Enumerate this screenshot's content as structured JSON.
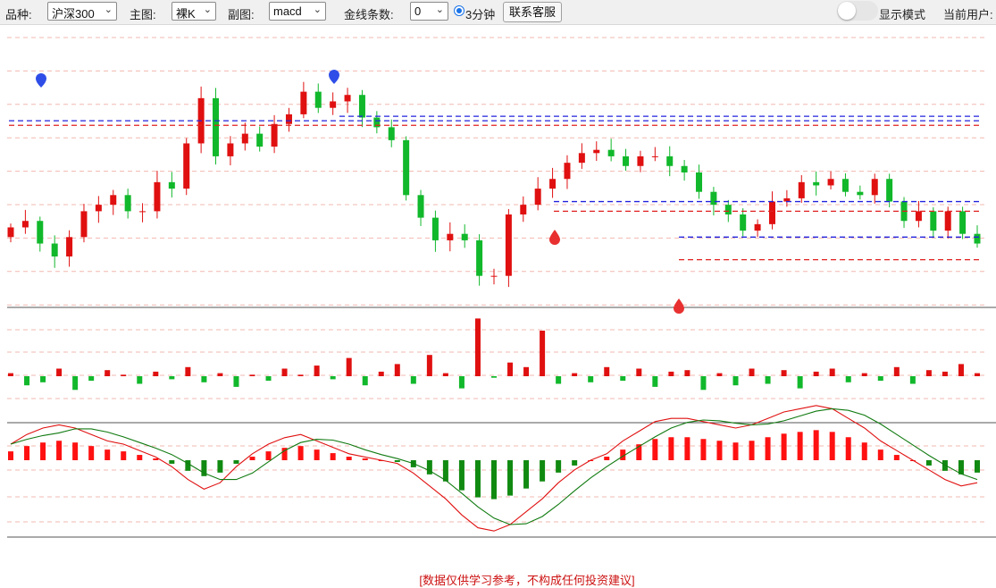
{
  "toolbar": {
    "variety_label": "品种:",
    "variety_value": "沪深300",
    "main_label": "主图:",
    "main_value": "裸K",
    "sub_label": "副图:",
    "sub_value": "macd",
    "lines_label": "金线条数:",
    "lines_value": "0",
    "period_label": "3分钟",
    "contact_label": "联系客服",
    "display_mode_label": "显示模式",
    "current_user_label": "当前用户:"
  },
  "disclaimer": "[数据仅供学习参考，不构成任何投资建议]",
  "icons": [
    "chevron-down-icon",
    "radio-selected-icon",
    "toggle-switch-icon",
    "map-pin-icon",
    "drop-marker-icon"
  ],
  "colors": {
    "up": "#e01010",
    "down": "#11b82b",
    "dif": "#e01010",
    "dea": "#107a10",
    "macd_up": "#ff1111",
    "macd_down": "#118a11",
    "level_blue": "#2222dd",
    "level_red": "#e02020",
    "pin_blue": "#2f4ee8",
    "pin_red": "#e83030"
  },
  "chart_data": [
    {
      "type": "candlestick",
      "title": "",
      "close": [
        0.8,
        0.9,
        0.55,
        0.35,
        0.65,
        1.05,
        1.15,
        1.3,
        1.05,
        1.05,
        1.5,
        1.4,
        2.1,
        2.8,
        1.9,
        2.1,
        2.25,
        2.05,
        2.4,
        2.55,
        2.9,
        2.65,
        2.75,
        2.85,
        2.5,
        2.35,
        2.15,
        1.3,
        0.95,
        0.6,
        0.7,
        0.6,
        0.05,
        0.05,
        1.0,
        1.15,
        1.4,
        1.55,
        1.8,
        1.95,
        2.0,
        1.9,
        1.75,
        1.9,
        1.9,
        1.75,
        1.65,
        1.35,
        1.15,
        1.0,
        0.75,
        0.85,
        1.2,
        1.25,
        1.5,
        1.45,
        1.55,
        1.35,
        1.3,
        1.55,
        1.2,
        0.9,
        1.05,
        0.75,
        1.05,
        0.7,
        0.55
      ]
    },
    {
      "type": "bar",
      "title": "",
      "values": [
        0.2,
        -0.6,
        -0.4,
        0.5,
        -0.9,
        -0.3,
        0.4,
        0.1,
        -0.5,
        0.3,
        -0.2,
        0.6,
        -0.4,
        0.2,
        -0.7,
        0.1,
        -0.3,
        0.5,
        0.1,
        0.7,
        -0.2,
        1.2,
        -0.6,
        0.3,
        0.8,
        -0.5,
        1.4,
        0.2,
        -0.8,
        3.8,
        -0.1,
        0.9,
        0.6,
        3.0,
        -0.5,
        0.2,
        -0.4,
        0.6,
        -0.3,
        0.5,
        -0.7,
        0.3,
        0.4,
        -0.9,
        0.2,
        -0.6,
        0.5,
        -0.5,
        0.4,
        -0.8,
        0.3,
        0.5,
        -0.4,
        0.2,
        -0.3,
        0.6,
        -0.5,
        0.4,
        0.3,
        0.8,
        0.2
      ]
    },
    {
      "type": "bar",
      "title": "",
      "values": [
        0.5,
        0.8,
        1.0,
        1.1,
        1.0,
        0.8,
        0.6,
        0.5,
        0.3,
        0.1,
        -0.2,
        -0.6,
        -0.9,
        -0.7,
        -0.2,
        0.2,
        0.5,
        0.7,
        0.8,
        0.6,
        0.4,
        0.2,
        0.1,
        0.0,
        -0.1,
        -0.4,
        -0.8,
        -1.2,
        -1.7,
        -2.1,
        -2.2,
        -2.0,
        -1.6,
        -1.2,
        -0.7,
        -0.3,
        0.0,
        0.2,
        0.6,
        0.9,
        1.2,
        1.3,
        1.3,
        1.2,
        1.1,
        1.0,
        1.1,
        1.3,
        1.5,
        1.6,
        1.7,
        1.6,
        1.3,
        1.0,
        0.6,
        0.3,
        0.0,
        -0.3,
        -0.6,
        -0.8,
        -0.7
      ]
    }
  ]
}
